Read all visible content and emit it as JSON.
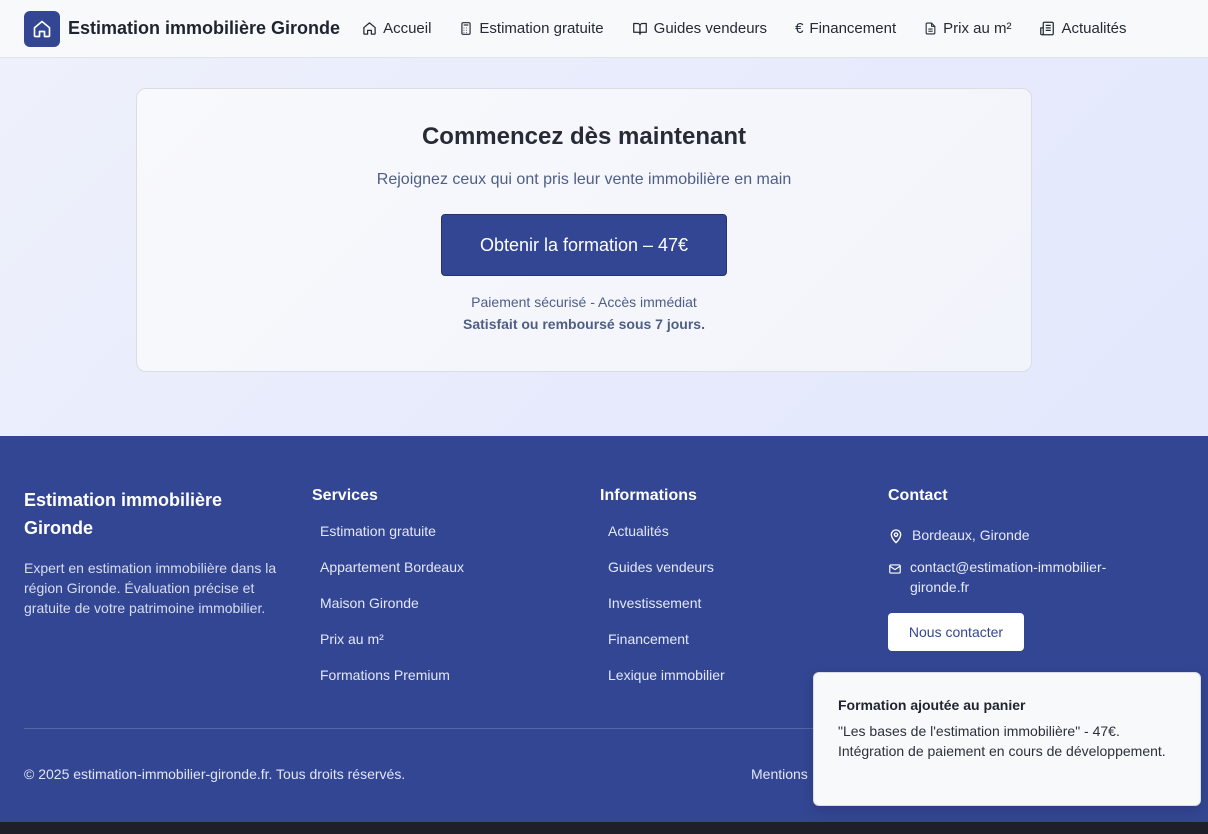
{
  "header": {
    "brand": "Estimation immobilière Gironde",
    "nav": [
      {
        "label": "Accueil",
        "icon": "home-icon"
      },
      {
        "label": "Estimation gratuite",
        "icon": "calculator-icon"
      },
      {
        "label": "Guides vendeurs",
        "icon": "book-icon"
      },
      {
        "label": "Financement",
        "icon": "euro-icon"
      },
      {
        "label": "Prix au m²",
        "icon": "document-icon"
      },
      {
        "label": "Actualités",
        "icon": "newspaper-icon"
      }
    ]
  },
  "cta_section": {
    "title": "Commencez dès maintenant",
    "subtitle": "Rejoignez ceux qui ont pris leur vente immobilière en main",
    "button": "Obtenir la formation – 47€",
    "payment_note": "Paiement sécurisé - Accès immédiat",
    "guarantee": "Satisfait ou remboursé sous 7 jours."
  },
  "footer": {
    "brand": "Estimation immobilière Gironde",
    "description": "Expert en estimation immobilière dans la région Gironde. Évaluation précise et gratuite de votre patrimoine immobilier.",
    "services": {
      "title": "Services",
      "links": [
        "Estimation gratuite",
        "Appartement Bordeaux",
        "Maison Gironde",
        "Prix au m²",
        "Formations Premium"
      ]
    },
    "informations": {
      "title": "Informations",
      "links": [
        "Actualités",
        "Guides vendeurs",
        "Investissement",
        "Financement",
        "Lexique immobilier"
      ]
    },
    "contact": {
      "title": "Contact",
      "location": "Bordeaux, Gironde",
      "email": "contact@estimation-immobilier-gironde.fr",
      "button": "Nous contacter"
    },
    "copyright": "© 2025 estimation-immobilier-gironde.fr. Tous droits réservés.",
    "legal_partial": "Mentions"
  },
  "toast": {
    "title": "Formation ajoutée au panier",
    "body": "\"Les bases de l'estimation immobilière\" - 47€. Intégration de paiement en cours de développement."
  },
  "colors": {
    "primary": "#334693",
    "hero_bg": "#e8ebfb",
    "header_bg": "#f7f9fa"
  }
}
